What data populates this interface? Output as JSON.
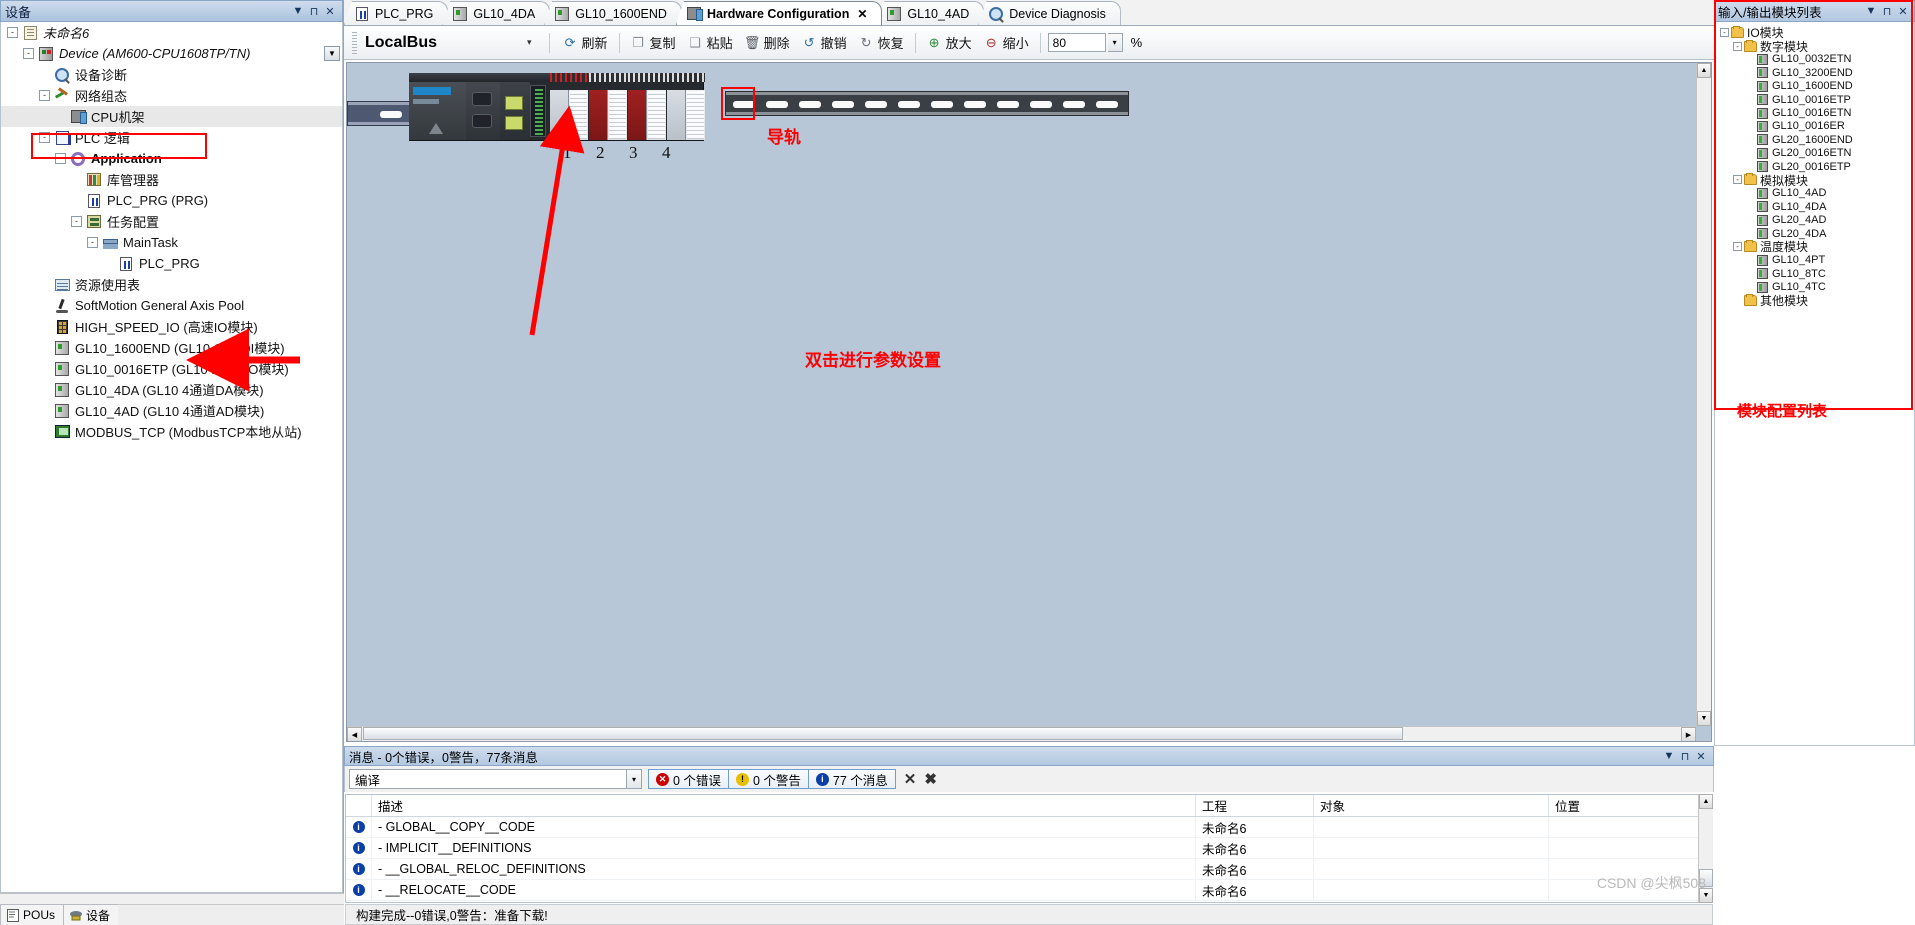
{
  "left_panel": {
    "header_title": "设备",
    "header_buttons": [
      "▼",
      "⊓",
      "✕"
    ],
    "tree": [
      {
        "label": "未命名6",
        "icon": "project-icon",
        "depth": 0,
        "expander": "-",
        "italic": true
      },
      {
        "label": "Device (AM600-CPU1608TP/TN)",
        "icon": "device-icon",
        "depth": 1,
        "expander": "-",
        "italic": true
      },
      {
        "label": "设备诊断",
        "icon": "diagnostics-icon",
        "depth": 2,
        "expander": "",
        "italic": false
      },
      {
        "label": "网络组态",
        "icon": "network-config-icon",
        "depth": 2,
        "expander": "-",
        "italic": false
      },
      {
        "label": "CPU机架",
        "icon": "cpu-rack-icon",
        "depth": 3,
        "expander": "",
        "italic": false,
        "selected": true
      },
      {
        "label": "PLC 逻辑",
        "icon": "plc-logic-icon",
        "depth": 2,
        "expander": "-",
        "italic": false
      },
      {
        "label": "Application",
        "icon": "application-icon",
        "depth": 3,
        "expander": "-",
        "bold": true
      },
      {
        "label": "库管理器",
        "icon": "library-manager-icon",
        "depth": 4,
        "expander": ""
      },
      {
        "label": "PLC_PRG (PRG)",
        "icon": "program-icon",
        "depth": 4,
        "expander": ""
      },
      {
        "label": "任务配置",
        "icon": "task-config-icon",
        "depth": 4,
        "expander": "-"
      },
      {
        "label": "MainTask",
        "icon": "main-task-icon",
        "depth": 5,
        "expander": "-"
      },
      {
        "label": "PLC_PRG",
        "icon": "program-ref-icon",
        "depth": 6,
        "expander": ""
      },
      {
        "label": "资源使用表",
        "icon": "resource-table-icon",
        "depth": 2,
        "expander": ""
      },
      {
        "label": "SoftMotion General Axis Pool",
        "icon": "axis-pool-icon",
        "depth": 2,
        "expander": ""
      },
      {
        "label": "HIGH_SPEED_IO (高速IO模块)",
        "icon": "high-speed-io-icon",
        "depth": 2,
        "expander": ""
      },
      {
        "label": "GL10_1600END (GL10 16点DI模块)",
        "icon": "io-module-icon",
        "depth": 2,
        "expander": ""
      },
      {
        "label": "GL10_0016ETP (GL10 16点DO模块)",
        "icon": "io-module-icon",
        "depth": 2,
        "expander": ""
      },
      {
        "label": "GL10_4DA (GL10 4通道DA模块)",
        "icon": "io-module-icon",
        "depth": 2,
        "expander": ""
      },
      {
        "label": "GL10_4AD (GL10 4通道AD模块)",
        "icon": "io-module-icon",
        "depth": 2,
        "expander": ""
      },
      {
        "label": "MODBUS_TCP (ModbusTCP本地从站)",
        "icon": "modbus-tcp-icon",
        "depth": 2,
        "expander": ""
      }
    ],
    "bottom_tabs": [
      {
        "label": "POUs",
        "icon": "pous-icon"
      },
      {
        "label": "设备",
        "icon": "devices-icon"
      }
    ]
  },
  "editor": {
    "tabs": [
      {
        "label": "PLC_PRG",
        "icon": "program-icon",
        "active": false,
        "closable": false
      },
      {
        "label": "GL10_4DA",
        "icon": "io-module-icon",
        "active": false,
        "closable": false
      },
      {
        "label": "GL10_1600END",
        "icon": "io-module-icon",
        "active": false,
        "closable": false
      },
      {
        "label": "Hardware Configuration",
        "icon": "hardware-config-icon",
        "active": true,
        "closable": true
      },
      {
        "label": "GL10_4AD",
        "icon": "io-module-icon",
        "active": false,
        "closable": false
      },
      {
        "label": "Device Diagnosis",
        "icon": "diagnostics-icon",
        "active": false,
        "closable": false
      }
    ],
    "close_glyph": "✕",
    "toolbar": {
      "bus_name": "LocalBus",
      "bus_caret": "▾",
      "buttons": [
        {
          "label": "刷新",
          "icon": "refresh-icon"
        },
        {
          "label": "复制",
          "icon": "copy-icon"
        },
        {
          "label": "粘贴",
          "icon": "paste-icon"
        },
        {
          "label": "删除",
          "icon": "delete-icon"
        },
        {
          "label": "撤销",
          "icon": "undo-icon"
        },
        {
          "label": "恢复",
          "icon": "redo-icon"
        },
        {
          "label": "放大",
          "icon": "zoom-in-icon"
        },
        {
          "label": "缩小",
          "icon": "zoom-out-icon"
        }
      ],
      "zoom_value": "80",
      "zoom_caret": "▾",
      "zoom_unit": "%"
    },
    "canvas": {
      "rack_slot_numbers": [
        "1",
        "2",
        "3",
        "4"
      ],
      "annotations": {
        "rail_label": "导轨",
        "param_label": "双击进行参数设置"
      },
      "annotation_color": "#fe0000"
    }
  },
  "messages": {
    "header_title": "消息 - 0个错误，0警告，77条消息",
    "filter_value": "编译",
    "filter_caret": "▾",
    "counters": [
      {
        "label": "0 个错误",
        "icon": "error-icon",
        "color": "#cc0000"
      },
      {
        "label": "0 个警告",
        "icon": "warning-icon",
        "color": "#e8c000"
      },
      {
        "label": "77 个消息",
        "icon": "info-icon",
        "color": "#0b3fa8"
      }
    ],
    "clear_glyph": "✕",
    "clear_all_glyph": "✖",
    "columns": [
      "描述",
      "工程",
      "对象",
      "位置"
    ],
    "rows": [
      {
        "icon": "info-icon",
        "desc": "- GLOBAL__COPY__CODE",
        "project": "未命名6",
        "object": "",
        "position": ""
      },
      {
        "icon": "info-icon",
        "desc": "- IMPLICIT__DEFINITIONS",
        "project": "未命名6",
        "object": "",
        "position": ""
      },
      {
        "icon": "info-icon",
        "desc": "- __GLOBAL_RELOC_DEFINITIONS",
        "project": "未命名6",
        "object": "",
        "position": ""
      },
      {
        "icon": "info-icon",
        "desc": "- __RELOCATE__CODE",
        "project": "未命名6",
        "object": "",
        "position": ""
      }
    ],
    "status_text": "构建完成--0错误,0警告：准备下载!",
    "watermark": "CSDN @尖枫508"
  },
  "right_panel": {
    "header_title": "输入/输出模块列表",
    "header_buttons": [
      "▼",
      "⊓",
      "✕"
    ],
    "annotation": "模块配置列表",
    "annotation_color": "#fe0000",
    "tree": [
      {
        "label": "IO模块",
        "type": "folder",
        "depth": 0,
        "expander": "-"
      },
      {
        "label": "数字模块",
        "type": "folder",
        "depth": 1,
        "expander": "-"
      },
      {
        "label": "GL10_0032ETN",
        "type": "module",
        "depth": 2,
        "expander": ""
      },
      {
        "label": "GL10_3200END",
        "type": "module",
        "depth": 2,
        "expander": ""
      },
      {
        "label": "GL10_1600END",
        "type": "module",
        "depth": 2,
        "expander": ""
      },
      {
        "label": "GL10_0016ETP",
        "type": "module",
        "depth": 2,
        "expander": ""
      },
      {
        "label": "GL10_0016ETN",
        "type": "module",
        "depth": 2,
        "expander": ""
      },
      {
        "label": "GL10_0016ER",
        "type": "module",
        "depth": 2,
        "expander": ""
      },
      {
        "label": "GL20_1600END",
        "type": "module",
        "depth": 2,
        "expander": ""
      },
      {
        "label": "GL20_0016ETN",
        "type": "module",
        "depth": 2,
        "expander": ""
      },
      {
        "label": "GL20_0016ETP",
        "type": "module",
        "depth": 2,
        "expander": ""
      },
      {
        "label": "模拟模块",
        "type": "folder",
        "depth": 1,
        "expander": "-"
      },
      {
        "label": "GL10_4AD",
        "type": "module",
        "depth": 2,
        "expander": ""
      },
      {
        "label": "GL10_4DA",
        "type": "module",
        "depth": 2,
        "expander": ""
      },
      {
        "label": "GL20_4AD",
        "type": "module",
        "depth": 2,
        "expander": ""
      },
      {
        "label": "GL20_4DA",
        "type": "module",
        "depth": 2,
        "expander": ""
      },
      {
        "label": "温度模块",
        "type": "folder",
        "depth": 1,
        "expander": "-"
      },
      {
        "label": "GL10_4PT",
        "type": "module",
        "depth": 2,
        "expander": ""
      },
      {
        "label": "GL10_8TC",
        "type": "module",
        "depth": 2,
        "expander": ""
      },
      {
        "label": "GL10_4TC",
        "type": "module",
        "depth": 2,
        "expander": ""
      },
      {
        "label": "其他模块",
        "type": "folder",
        "depth": 1,
        "expander": ""
      }
    ]
  }
}
